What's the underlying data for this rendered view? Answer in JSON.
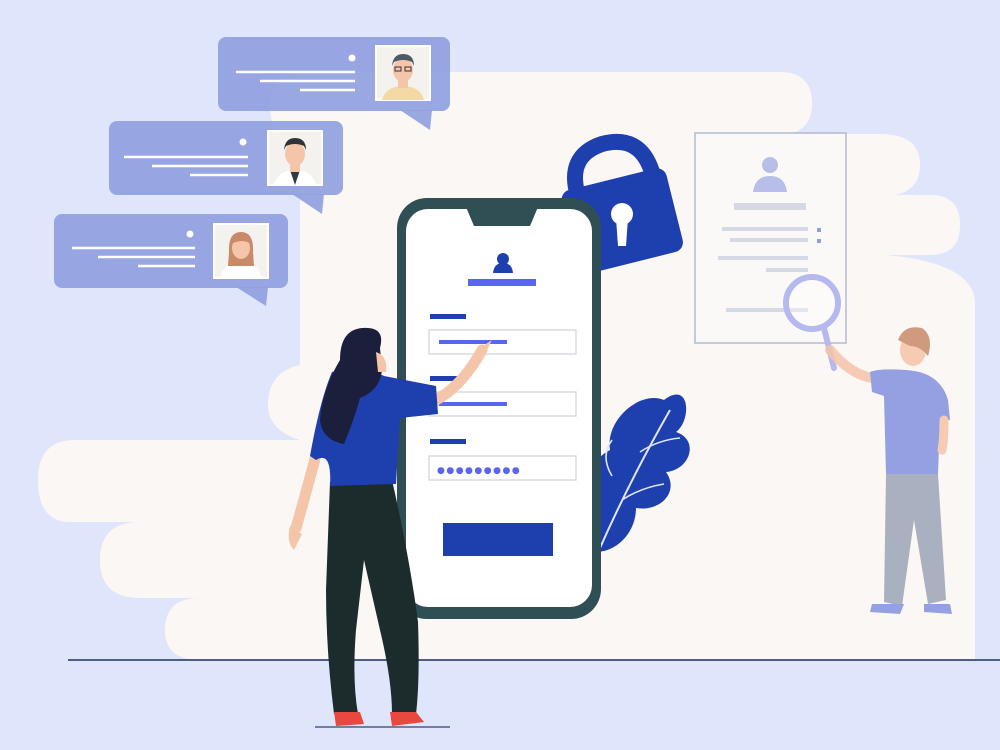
{
  "colors": {
    "background": "#dfe6fb",
    "cloud": "#fbf7f4",
    "phone_frame": "#2f4f55",
    "brand_blue": "#1e3fae",
    "accent_blue": "#5865f2",
    "bubble": "#8f9fe0",
    "skin": "#f4c5a8",
    "hair_dark": "#1b1f3b",
    "pants_dark": "#1c2b2b",
    "shoe": "#e8483d",
    "man_shirt": "#8392de",
    "man_pants": "#9ba4b8"
  },
  "chat_bubbles": [
    {
      "avatar": "man-with-glasses-avatar"
    },
    {
      "avatar": "man-avatar"
    },
    {
      "avatar": "woman-avatar"
    }
  ],
  "login_form": {
    "password_mask": "●●●●●●●●●"
  },
  "icons": [
    "user-icon",
    "padlock-icon",
    "magnifier-icon",
    "leaf-icon"
  ]
}
